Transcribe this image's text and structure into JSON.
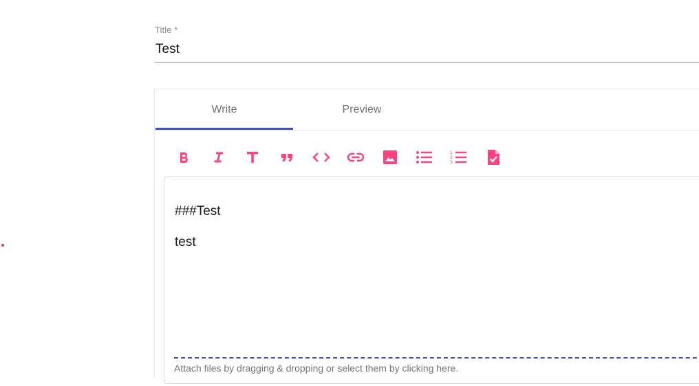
{
  "title_field": {
    "label": "Title *",
    "value": "Test"
  },
  "editor": {
    "tabs": [
      {
        "label": "Write",
        "active": true
      },
      {
        "label": "Preview",
        "active": false
      }
    ],
    "toolbar": [
      {
        "icon": "bold-icon",
        "title": "Add bold text"
      },
      {
        "icon": "italic-icon",
        "title": "Add italic text"
      },
      {
        "icon": "header-icon",
        "title": "Add header text"
      },
      {
        "icon": "quote-icon",
        "title": "Insert a quote"
      },
      {
        "icon": "code-icon",
        "title": "Insert code"
      },
      {
        "icon": "link-icon",
        "title": "Add a link"
      },
      {
        "icon": "image-icon",
        "title": "Add image"
      },
      {
        "icon": "unordered-list-icon",
        "title": "Add a bulleted list"
      },
      {
        "icon": "ordered-list-icon",
        "title": "Add a numbered list"
      },
      {
        "icon": "checked-list-icon",
        "title": "Add a task list"
      }
    ],
    "content_lines": [
      "###Test",
      "test"
    ],
    "drop_hint": "Attach files by dragging & dropping or select them by clicking here.",
    "accent_color": "#ff4081",
    "indicator_color": "#3f51b5"
  }
}
